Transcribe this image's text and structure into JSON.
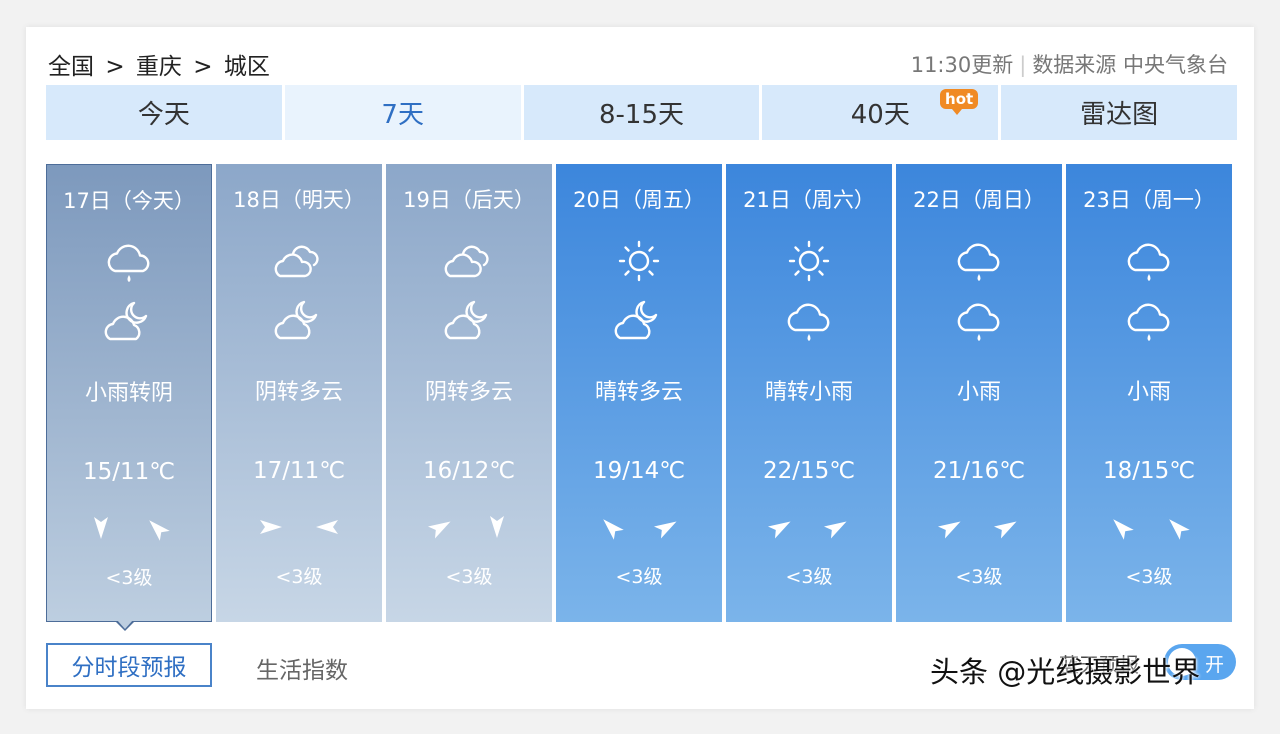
{
  "breadcrumb": {
    "country": "全国",
    "sep": ">",
    "city": "重庆",
    "district": "城区"
  },
  "header": {
    "update": "11:30更新",
    "source_label": "数据来源",
    "source": "中央气象台"
  },
  "tabs": [
    {
      "label": "今天"
    },
    {
      "label": "7天",
      "active": true
    },
    {
      "label": "8-15天"
    },
    {
      "label": "40天",
      "badge": "hot"
    },
    {
      "label": "雷达图"
    }
  ],
  "days": [
    {
      "date": "17日（今天）",
      "icon1": "rain-cloud-icon",
      "icon2": "partly-cloudy-night-icon",
      "desc": "小雨转阴",
      "temp": "15/11℃",
      "wind1": "wind-arrow-icon",
      "wind2": "wind-arrow-icon",
      "level": "<3级"
    },
    {
      "date": "18日（明天）",
      "icon1": "overcast-icon",
      "icon2": "partly-cloudy-night-icon",
      "desc": "阴转多云",
      "temp": "17/11℃",
      "wind1": "wind-arrow-icon",
      "wind2": "wind-arrow-icon",
      "level": "<3级"
    },
    {
      "date": "19日（后天）",
      "icon1": "overcast-icon",
      "icon2": "partly-cloudy-night-icon",
      "desc": "阴转多云",
      "temp": "16/12℃",
      "wind1": "wind-arrow-icon",
      "wind2": "wind-arrow-icon",
      "level": "<3级"
    },
    {
      "date": "20日（周五）",
      "icon1": "sun-icon",
      "icon2": "partly-cloudy-night-icon",
      "desc": "晴转多云",
      "temp": "19/14℃",
      "wind1": "wind-arrow-icon",
      "wind2": "wind-arrow-icon",
      "level": "<3级"
    },
    {
      "date": "21日（周六）",
      "icon1": "sun-icon",
      "icon2": "rain-cloud-icon",
      "desc": "晴转小雨",
      "temp": "22/15℃",
      "wind1": "wind-arrow-icon",
      "wind2": "wind-arrow-icon",
      "level": "<3级"
    },
    {
      "date": "22日（周日）",
      "icon1": "rain-cloud-icon",
      "icon2": "rain-cloud-icon",
      "desc": "小雨",
      "temp": "21/16℃",
      "wind1": "wind-arrow-icon",
      "wind2": "wind-arrow-icon",
      "level": "<3级"
    },
    {
      "date": "23日（周一）",
      "icon1": "rain-cloud-icon",
      "icon2": "rain-cloud-icon",
      "desc": "小雨",
      "temp": "18/15℃",
      "wind1": "wind-arrow-icon",
      "wind2": "wind-arrow-icon",
      "level": "<3级"
    }
  ],
  "bottom": {
    "hourly": "分时段预报",
    "life": "生活指数",
    "bluesky": "蓝天预报",
    "toggle": "开"
  },
  "watermark": "头条 @光线摄影世界",
  "colors": {
    "accent": "#2f6fc3",
    "tab_bg": "#d7e9fb",
    "future_top": "#3c86dc",
    "past_top": "#8ca7c9",
    "hot": "#f08a24"
  }
}
